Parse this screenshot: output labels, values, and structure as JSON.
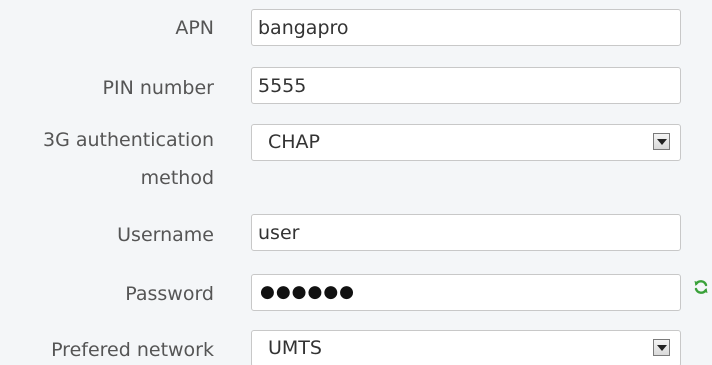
{
  "form": {
    "apn": {
      "label": "APN",
      "value": "bangapro"
    },
    "pin": {
      "label": "PIN number",
      "value": "5555"
    },
    "auth_method": {
      "label": "3G authentication method",
      "value": "CHAP"
    },
    "username": {
      "label": "Username",
      "value": "user"
    },
    "password": {
      "label": "Password",
      "value": "●●●●●●"
    },
    "preferred_network": {
      "label": "Prefered network",
      "value": "UMTS"
    }
  },
  "icons": {
    "password_action": "refresh-icon"
  },
  "colors": {
    "label": "#555555",
    "background": "#f4f6f8",
    "field_border": "#c8c8c8",
    "icon_green": "#3aa13a"
  }
}
